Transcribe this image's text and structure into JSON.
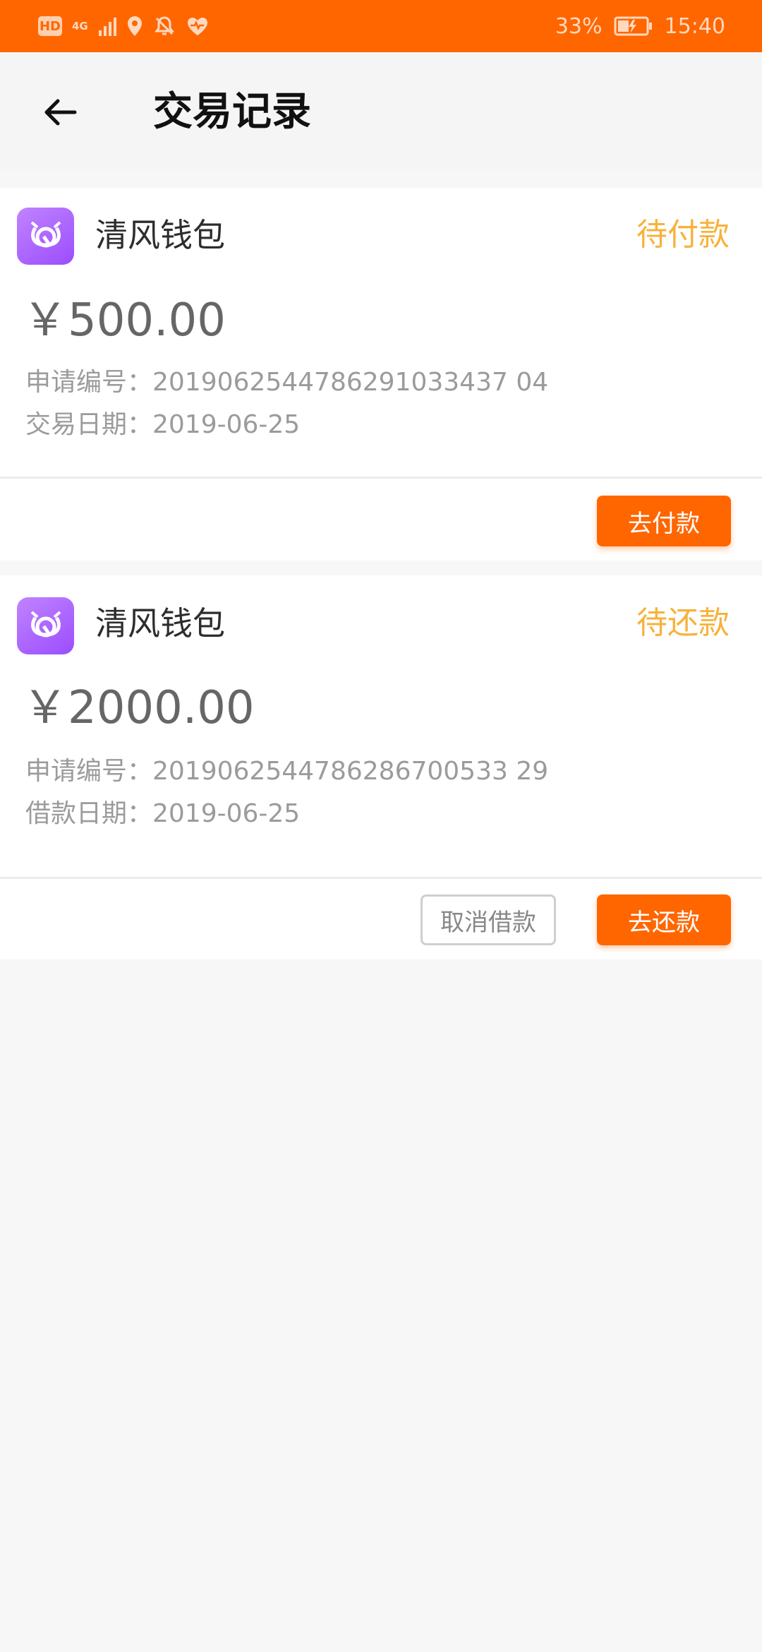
{
  "status_bar": {
    "hd": "HD",
    "network": "4G",
    "battery": "33%",
    "time": "15:40"
  },
  "header": {
    "title": "交易记录",
    "back_icon": "arrow-left-icon"
  },
  "records": [
    {
      "wallet_name": "清风钱包",
      "status": "待付款",
      "amount": "￥500.00",
      "application_no": "申请编号：2019062544786291033437 04",
      "date_line": "交易日期：2019-06-25",
      "primary_button": "去付款"
    },
    {
      "wallet_name": "清风钱包",
      "status": "待还款",
      "amount": "￥2000.00",
      "application_no": "申请编号：2019062544786286700533 29",
      "date_line": "借款日期：2019-06-25",
      "secondary_button": "取消借款",
      "primary_button": "去还款"
    }
  ],
  "colors": {
    "accent": "#ff6600",
    "status": "#f7b23b",
    "logo": "#a85cff"
  }
}
